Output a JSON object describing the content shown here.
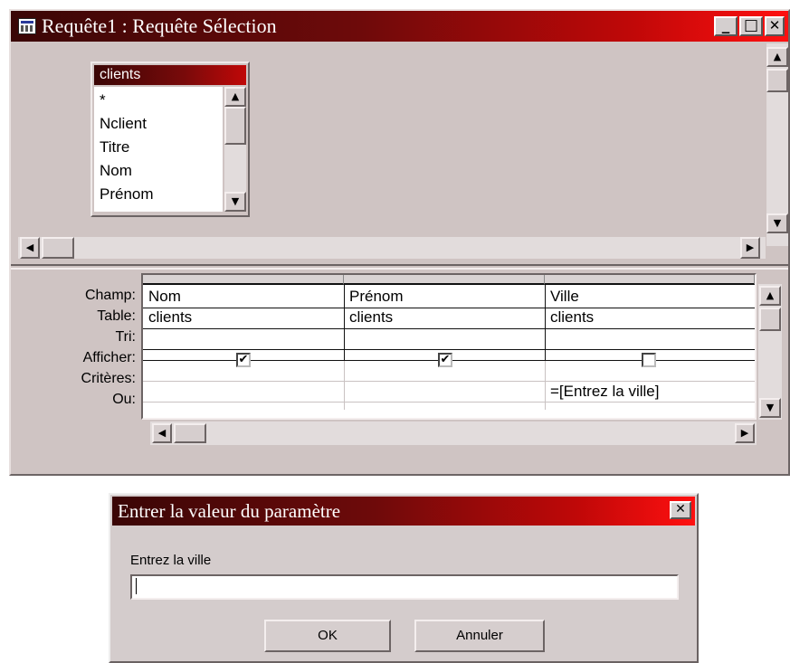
{
  "query_window": {
    "title": "Requête1 : Requête Sélection",
    "buttons": {
      "minimize": "_",
      "maximize": "□",
      "close": "✕"
    }
  },
  "table_list": {
    "title": "clients",
    "fields": [
      "*",
      "Nclient",
      "Titre",
      "Nom",
      "Prénom"
    ]
  },
  "grid": {
    "row_labels": [
      "Champ:",
      "Table:",
      "Tri:",
      "Afficher:",
      "Critères:",
      "Ou:"
    ],
    "columns": [
      {
        "champ": "Nom",
        "table": "clients",
        "tri": "",
        "afficher": true,
        "criteres": "",
        "ou": ""
      },
      {
        "champ": "Prénom",
        "table": "clients",
        "tri": "",
        "afficher": true,
        "criteres": "",
        "ou": ""
      },
      {
        "champ": "Ville",
        "table": "clients",
        "tri": "",
        "afficher": false,
        "criteres": "=[Entrez la ville]",
        "ou": ""
      }
    ]
  },
  "dialog": {
    "title": "Entrer la valeur du paramètre",
    "close": "✕",
    "prompt": "Entrez la ville",
    "input_value": "",
    "ok_label": "OK",
    "cancel_label": "Annuler"
  },
  "icons": {
    "scroll_up": "▲",
    "scroll_down": "▼",
    "scroll_left": "◀",
    "scroll_right": "▶",
    "check": "✔"
  },
  "colors": {
    "titlebar_dark": "#3a0606",
    "titlebar_bright": "#ff1010",
    "window_bg": "#cfc4c3"
  }
}
